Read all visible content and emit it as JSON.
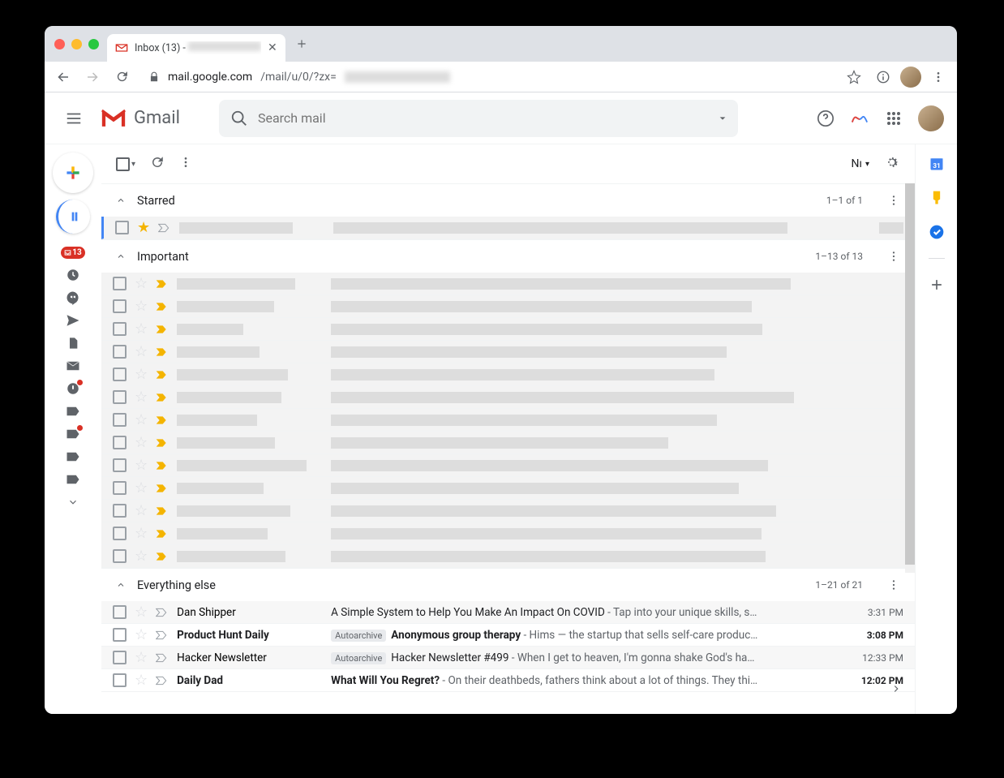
{
  "browser": {
    "tab_title": "Inbox (13) - ",
    "url_host": "mail.google.com",
    "url_path": "/mail/u/0/?zx="
  },
  "header": {
    "product": "Gmail",
    "search_placeholder": "Search mail"
  },
  "sidebar": {
    "inbox_count": "13"
  },
  "toolbar": {
    "split_label": "Nı"
  },
  "sections": {
    "starred": {
      "title": "Starred",
      "count": "1–1 of 1"
    },
    "important": {
      "title": "Important",
      "count": "1–13 of 13"
    },
    "else": {
      "title": "Everything else",
      "count": "1–21 of 21"
    }
  },
  "emails": [
    {
      "sender": "Dan Shipper",
      "subject": "A Simple System to Help You Make An Impact On COVID",
      "preview": " - Tap into your unique skills, s…",
      "time": "3:31 PM",
      "bold": false,
      "tag": ""
    },
    {
      "sender": "Product Hunt Daily",
      "subject": "Anonymous group therapy",
      "preview": " - Hims — the startup that sells self-care produc…",
      "time": "3:08 PM",
      "bold": true,
      "tag": "Autoarchive"
    },
    {
      "sender": "Hacker Newsletter",
      "subject": "Hacker Newsletter #499",
      "preview": " - When I get to heaven, I'm gonna shake God's ha…",
      "time": "12:33 PM",
      "bold": false,
      "tag": "Autoarchive"
    },
    {
      "sender": "Daily Dad",
      "subject": "What Will You Regret?",
      "preview": " - On their deathbeds, fathers think about a lot of things. They thi…",
      "time": "12:02 PM",
      "bold": true,
      "tag": ""
    }
  ]
}
